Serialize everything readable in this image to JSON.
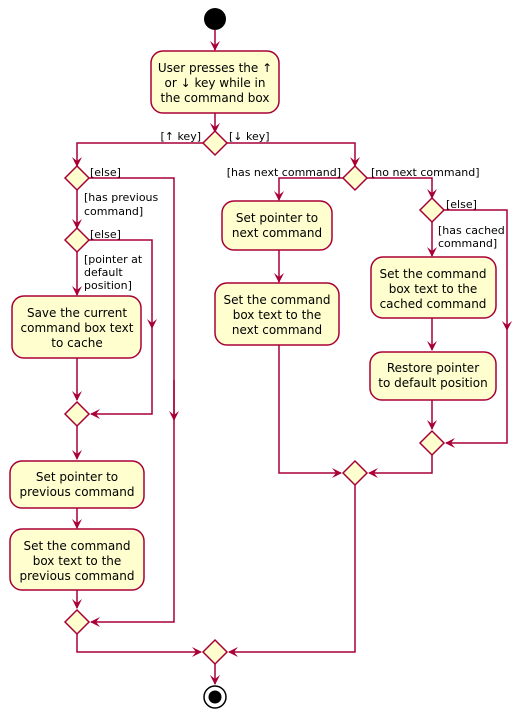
{
  "diagram": {
    "type": "UML activity diagram",
    "colors": {
      "line": "#A80036",
      "node_fill": "#FEFECE",
      "start_fill": "#000000",
      "background": "#FFFFFF"
    },
    "start": "initial-node",
    "end": "final-node",
    "actions": {
      "user_presses": [
        "User presses the ↑",
        "or ↓ key while in",
        "the command box"
      ],
      "save_current": [
        "Save the current",
        "command box text",
        "to cache"
      ],
      "set_pointer_prev": [
        "Set pointer to",
        "previous command"
      ],
      "set_text_prev": [
        "Set the command",
        "box text to the",
        "previous command"
      ],
      "set_pointer_next": [
        "Set pointer to",
        "next command"
      ],
      "set_text_next": [
        "Set the command",
        "box text to the",
        "next command"
      ],
      "set_text_cached": [
        "Set the command",
        "box text to the",
        "cached command"
      ],
      "restore_pointer": [
        "Restore pointer",
        "to default position"
      ]
    },
    "guards": {
      "up_key": "[↑ key]",
      "down_key": "[↓ key]",
      "else_has_prev": "[else]",
      "has_previous": [
        "[has previous",
        "command]"
      ],
      "else_pointer_default": "[else]",
      "pointer_default": [
        "[pointer at",
        "default",
        "position]"
      ],
      "has_next": "[has next command]",
      "no_next": "[no next command]",
      "else_cached": "[else]",
      "has_cached": [
        "[has cached",
        "command]"
      ]
    }
  }
}
